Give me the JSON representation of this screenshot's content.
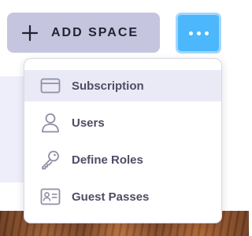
{
  "toolbar": {
    "add_space_label": "ADD SPACE",
    "add_space_icon": "plus-icon",
    "more_icon": "more-dots-icon",
    "more_button_color": "#4cb7fb"
  },
  "menu": {
    "items": [
      {
        "label": "Subscription",
        "icon": "credit-card-icon",
        "active": true
      },
      {
        "label": "Users",
        "icon": "user-icon",
        "active": false
      },
      {
        "label": "Define Roles",
        "icon": "key-icon",
        "active": false
      },
      {
        "label": "Guest Passes",
        "icon": "id-card-icon",
        "active": false
      }
    ],
    "active_bg": "#eaeaf7",
    "icon_color": "#8f8fa6",
    "text_color": "#4d4d66"
  }
}
